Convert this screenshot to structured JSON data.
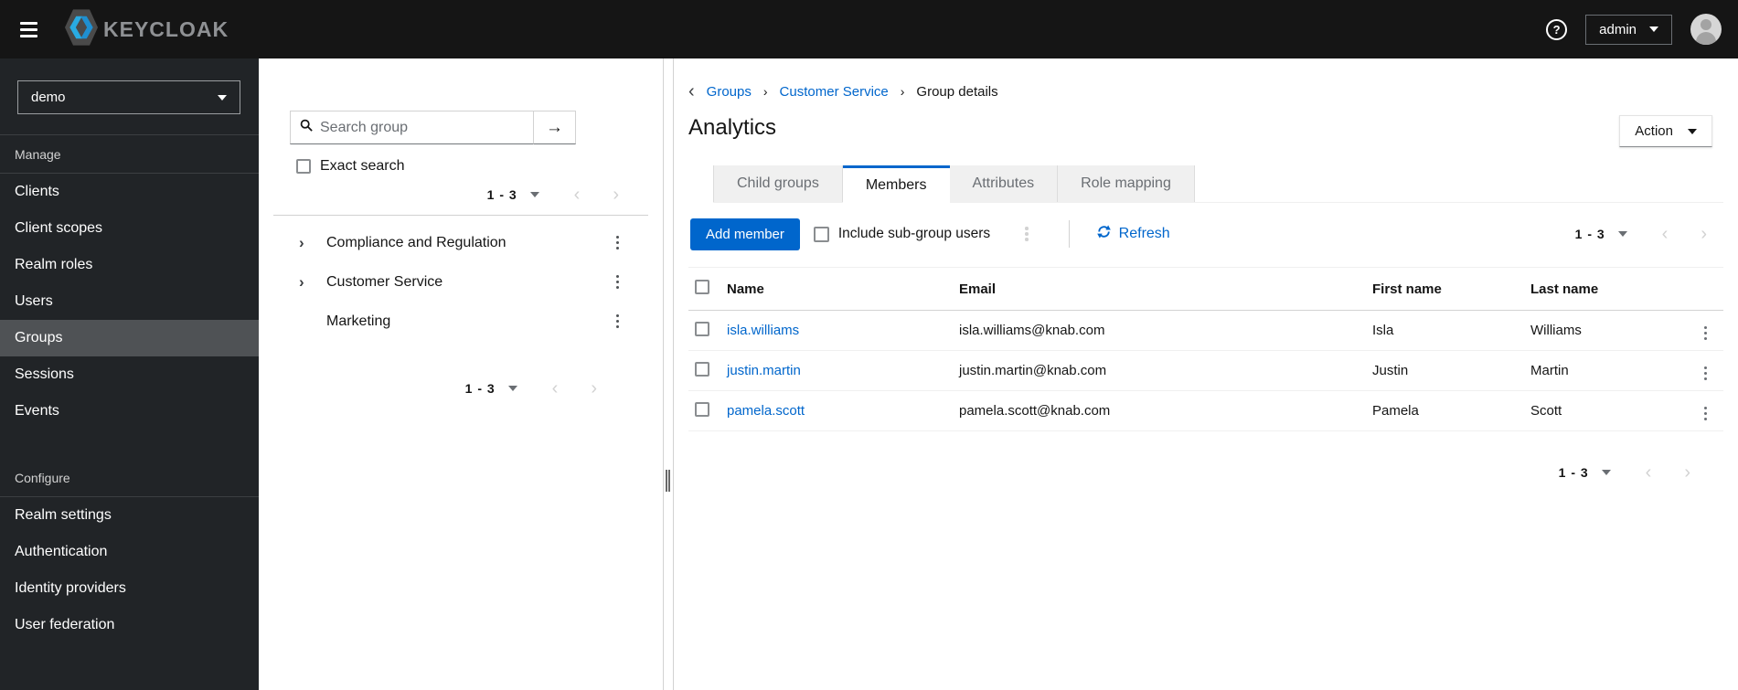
{
  "colors": {
    "accent": "#0066cc",
    "masthead_bg": "#151515",
    "sidebar_bg": "#212427",
    "sidebar_selected_bg": "#4f5255",
    "link": "#0066cc"
  },
  "glyphs": {
    "help": "?",
    "back": "‹",
    "forward": "›",
    "prev_page": "‹",
    "next_page": "›",
    "search_submit": "→"
  },
  "masthead": {
    "brand": "KEYCLOAK",
    "user_menu_label": "admin"
  },
  "sidebar": {
    "realm_select_value": "demo",
    "sections": [
      {
        "label": "Manage",
        "items": [
          "Clients",
          "Client scopes",
          "Realm roles",
          "Users",
          "Groups",
          "Sessions",
          "Events"
        ]
      },
      {
        "label": "Configure",
        "items": [
          "Realm settings",
          "Authentication",
          "Identity providers",
          "User federation"
        ]
      }
    ],
    "selected_item": "Groups"
  },
  "groups_panel": {
    "search_placeholder": "Search group",
    "exact_search_label": "Exact search",
    "pagination_top": "1 - 3",
    "pagination_bottom": "1 - 3",
    "tree": [
      {
        "label": "Compliance and Regulation",
        "expandable": true
      },
      {
        "label": "Customer Service",
        "expandable": true
      },
      {
        "label": "Marketing",
        "expandable": false
      }
    ]
  },
  "main": {
    "breadcrumb": {
      "items": [
        "Groups",
        "Customer Service",
        "Group details"
      ]
    },
    "title": "Analytics",
    "action_label": "Action",
    "tabs": [
      {
        "label": "Child groups",
        "active": false
      },
      {
        "label": "Members",
        "active": true
      },
      {
        "label": "Attributes",
        "active": false
      },
      {
        "label": "Role mapping",
        "active": false
      }
    ],
    "toolbar": {
      "add_member_label": "Add member",
      "include_subgroup_label": "Include sub-group users",
      "refresh_label": "Refresh",
      "pagination": "1 - 3"
    },
    "table": {
      "columns": [
        "Name",
        "Email",
        "First name",
        "Last name"
      ],
      "rows": [
        {
          "name": "isla.williams",
          "email": "isla.williams@knab.com",
          "first": "Isla",
          "last": "Williams"
        },
        {
          "name": "justin.martin",
          "email": "justin.martin@knab.com",
          "first": "Justin",
          "last": "Martin"
        },
        {
          "name": "pamela.scott",
          "email": "pamela.scott@knab.com",
          "first": "Pamela",
          "last": "Scott"
        }
      ]
    },
    "bottom_pagination": "1 - 3"
  }
}
